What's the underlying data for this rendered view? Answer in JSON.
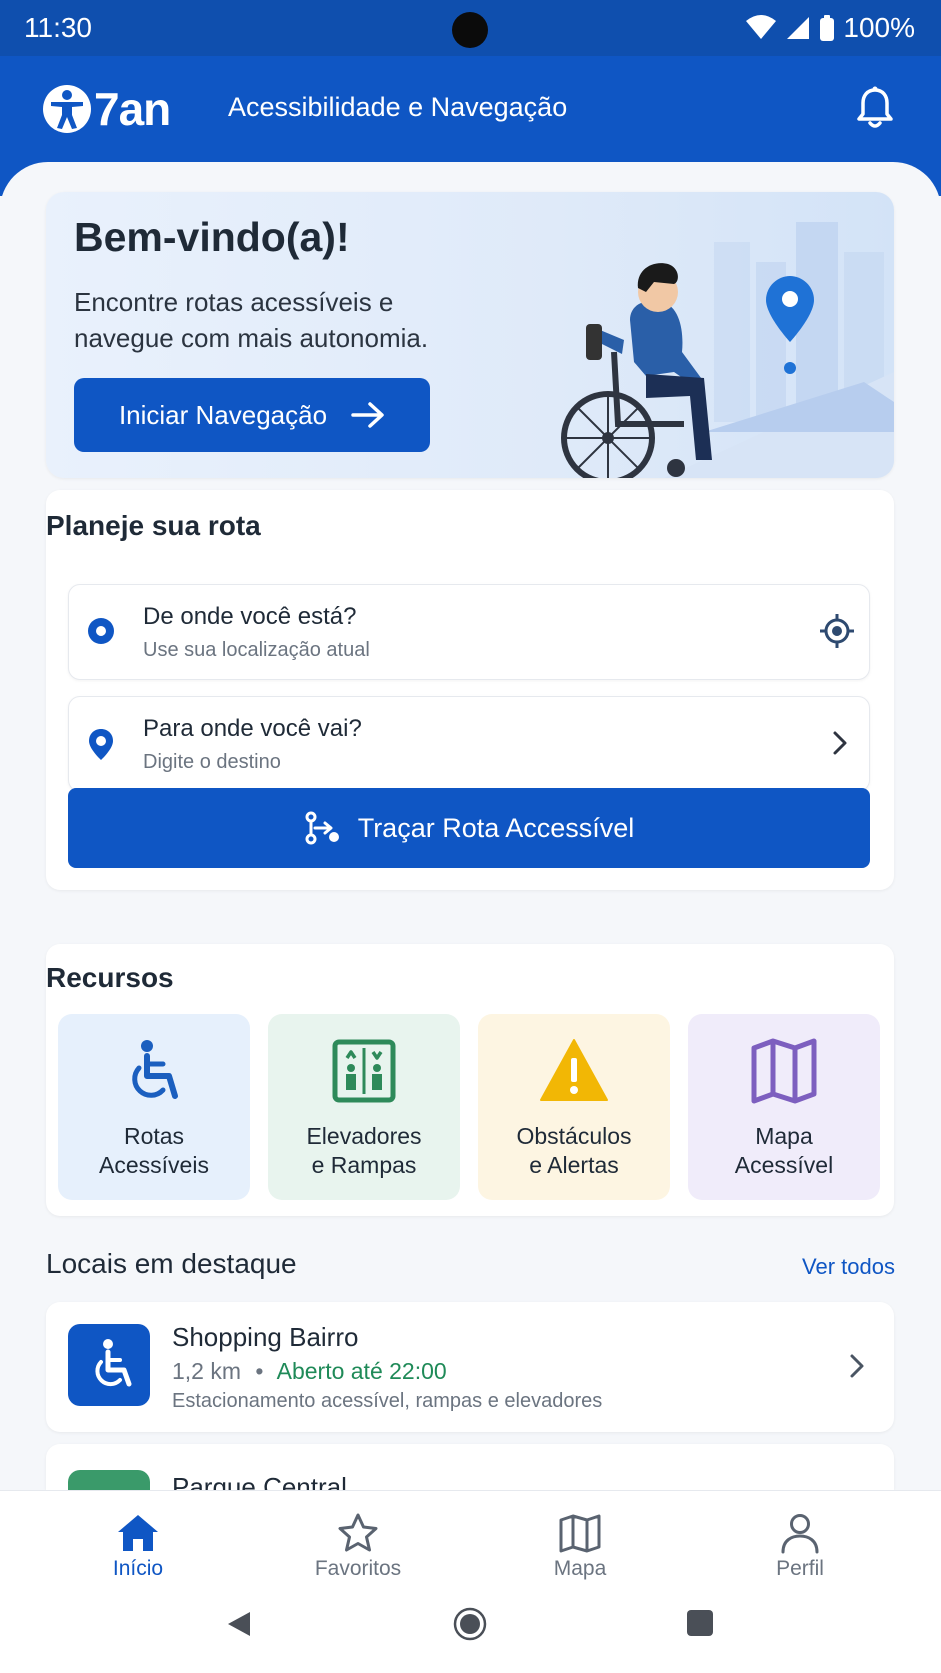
{
  "status_bar": {
    "time": "11:30",
    "battery": "100%"
  },
  "app_bar": {
    "logo_text": "7an",
    "title": "Acessibilidade e Navegação",
    "icons": [
      "accessibility-logo-icon",
      "bell-icon"
    ]
  },
  "hero": {
    "title": "Bem-vindo(a)!",
    "subtitle": "Encontre rotas acessíveis e navegue com mais autonomia.",
    "button_label": "Iniciar Navegação"
  },
  "route_planner": {
    "title": "Planeje sua rota",
    "origin": {
      "label": "De onde você está?",
      "hint": "Use sua localização atual"
    },
    "destination": {
      "label": "Para onde você vai?",
      "hint": "Digite o destino"
    },
    "button_label": "Traçar Rota Accessível"
  },
  "resources": {
    "title": "Recursos",
    "items": [
      {
        "label": "Rotas\nAcessíveis",
        "icon": "wheelchair-icon",
        "bg": "#e6f0fc",
        "color": "#1b5fbf"
      },
      {
        "label": "Elevadores\ne Rampas",
        "icon": "elevator-icon",
        "bg": "#e8f4ee",
        "color": "#2e8a5a"
      },
      {
        "label": "Obstáculos\ne Alertas",
        "icon": "warning-icon",
        "bg": "#fdf5e2",
        "color": "#f2b705"
      },
      {
        "label": "Mapa\nAcessível",
        "icon": "map-icon",
        "bg": "#f0ecfa",
        "color": "#7d5fbf"
      }
    ]
  },
  "featured": {
    "title": "Locais em destaque",
    "see_all": "Ver todos",
    "places": [
      {
        "name": "Shopping Bairro",
        "distance": "1,2 km",
        "separator": "•",
        "status": "Aberto até 22:00",
        "description": "Estacionamento acessível, rampas e elevadores",
        "thumb_color": "#0f56c4"
      },
      {
        "name": "Parque Central",
        "thumb_color": "#3a9a6a"
      }
    ]
  },
  "bottom_nav": {
    "items": [
      {
        "label": "Início",
        "icon": "home-icon",
        "active": true
      },
      {
        "label": "Favoritos",
        "icon": "star-icon",
        "active": false
      },
      {
        "label": "Mapa",
        "icon": "map-icon",
        "active": false
      },
      {
        "label": "Perfil",
        "icon": "person-icon",
        "active": false
      }
    ]
  },
  "colors": {
    "primary": "#0f56c4",
    "status_bar": "#0f4fae",
    "open_green": "#1f8a58"
  }
}
